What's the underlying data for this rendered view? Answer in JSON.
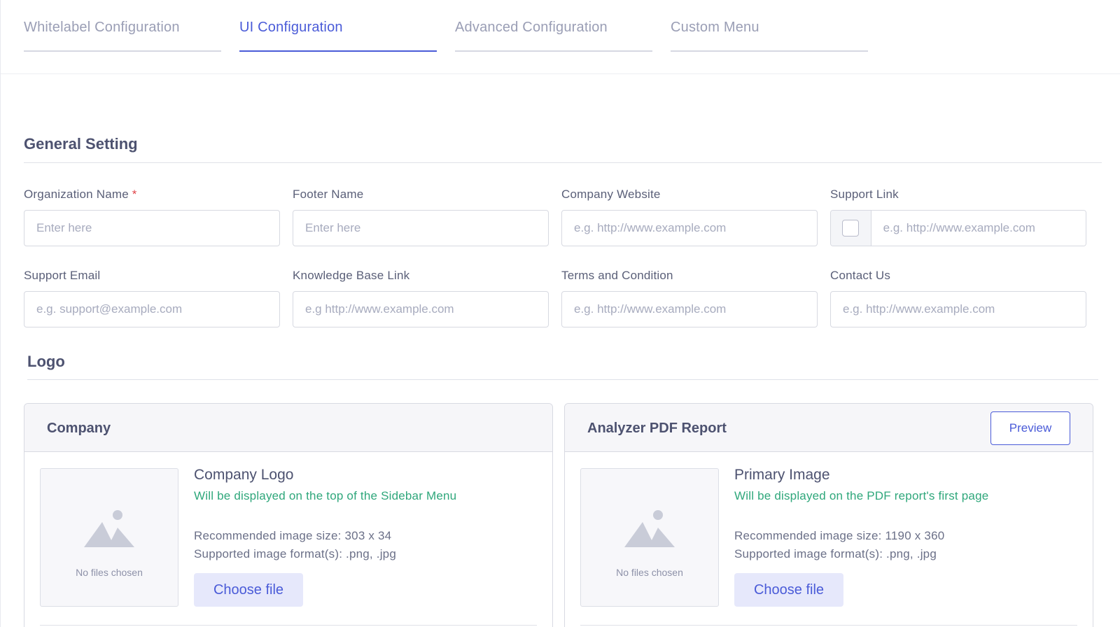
{
  "tabs": [
    {
      "label": "Whitelabel Configuration",
      "active": false
    },
    {
      "label": "UI Configuration",
      "active": true
    },
    {
      "label": "Advanced Configuration",
      "active": false
    },
    {
      "label": "Custom Menu",
      "active": false
    }
  ],
  "general": {
    "title": "General Setting",
    "fields": {
      "org_name": {
        "label": "Organization Name",
        "required_mark": "*",
        "placeholder": "Enter here"
      },
      "footer_name": {
        "label": "Footer Name",
        "placeholder": "Enter here"
      },
      "company_website": {
        "label": "Company Website",
        "placeholder": "e.g. http://www.example.com"
      },
      "support_link": {
        "label": "Support Link",
        "placeholder": "e.g. http://www.example.com",
        "checked": false
      },
      "support_email": {
        "label": "Support Email",
        "placeholder": "e.g. support@example.com"
      },
      "kb_link": {
        "label": "Knowledge Base Link",
        "placeholder": "e.g http://www.example.com"
      },
      "terms": {
        "label": "Terms and Condition",
        "placeholder": "e.g. http://www.example.com"
      },
      "contact": {
        "label": "Contact Us",
        "placeholder": "e.g. http://www.example.com"
      }
    }
  },
  "logo": {
    "title": "Logo",
    "company_card": {
      "title": "Company",
      "no_file": "No files chosen",
      "item_title": "Company Logo",
      "item_desc": "Will be displayed on the top of the Sidebar Menu",
      "size": "Recommended image size: 303 x 34",
      "formats": "Supported image format(s): .png, .jpg",
      "choose_label": "Choose file"
    },
    "pdf_card": {
      "title": "Analyzer PDF Report",
      "preview_label": "Preview",
      "no_file": "No files chosen",
      "item_title": "Primary Image",
      "item_desc": "Will be displayed on the PDF report's first page",
      "size": "Recommended image size: 1190 x 360",
      "formats": "Supported image format(s): .png, .jpg",
      "choose_label": "Choose file"
    }
  },
  "colors": {
    "accent": "#4a5bd8",
    "success_text": "#2fa77b",
    "required": "#e0464a"
  },
  "icons": {
    "image_placeholder": "image-placeholder-icon"
  }
}
